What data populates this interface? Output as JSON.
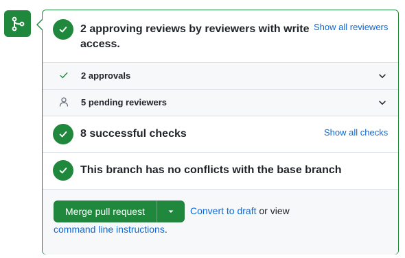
{
  "review": {
    "title": "2 approving reviews by reviewers with write access.",
    "link": "Show all reviewers"
  },
  "approvals": {
    "label": "2 approvals"
  },
  "pending": {
    "label": "5 pending reviewers"
  },
  "checks": {
    "title": "8 successful checks",
    "link": "Show all checks"
  },
  "conflicts": {
    "title": "This branch has no conflicts with the base branch"
  },
  "merge": {
    "button_label": "Merge pull request",
    "convert_link": "Convert to draft",
    "or_view": "or view",
    "cli_link": "command line instructions",
    "period": "."
  },
  "colors": {
    "success": "#1f883d",
    "link": "#0969da",
    "muted_bg": "#f6f8fa",
    "border": "#d8dee4"
  },
  "icons": [
    "git-merge-icon",
    "check-circle-icon",
    "check-icon",
    "person-icon",
    "chevron-down-icon",
    "triangle-down-icon"
  ]
}
